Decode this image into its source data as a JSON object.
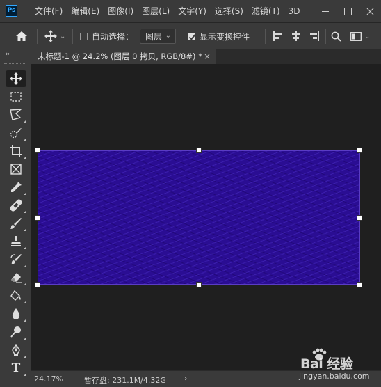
{
  "app": {
    "logo_text": "Ps",
    "menu": [
      "文件(F)",
      "编辑(E)",
      "图像(I)",
      "图层(L)",
      "文字(Y)",
      "选择(S)",
      "滤镜(T)",
      "3D"
    ]
  },
  "options_bar": {
    "auto_select_label": "自动选择：",
    "auto_select_checked": false,
    "target_dropdown_value": "图层",
    "show_transform_label": "显示变换控件",
    "show_transform_checked": true
  },
  "document_tab": {
    "title": "未标题-1 @ 24.2% (图层 0 拷贝, RGB/8#) *",
    "close_glyph": "×"
  },
  "tools": [
    {
      "name": "move-tool",
      "icon": "move-icon",
      "active": true
    },
    {
      "name": "marquee-tool",
      "icon": "rect-marquee-icon"
    },
    {
      "name": "lasso-tool",
      "icon": "polygon-lasso-icon"
    },
    {
      "name": "quick-select-tool",
      "icon": "quick-select-icon"
    },
    {
      "name": "crop-tool",
      "icon": "crop-icon"
    },
    {
      "name": "frame-tool",
      "icon": "frame-icon"
    },
    {
      "name": "eyedropper-tool",
      "icon": "eyedropper-icon"
    },
    {
      "name": "healing-tool",
      "icon": "bandage-icon"
    },
    {
      "name": "brush-tool",
      "icon": "brush-icon"
    },
    {
      "name": "stamp-tool",
      "icon": "clone-stamp-icon"
    },
    {
      "name": "history-brush-tool",
      "icon": "history-brush-icon"
    },
    {
      "name": "eraser-tool",
      "icon": "eraser-icon"
    },
    {
      "name": "paint-bucket-tool",
      "icon": "paint-bucket-icon"
    },
    {
      "name": "blur-tool",
      "icon": "droplet-icon"
    },
    {
      "name": "dodge-tool",
      "icon": "dodge-icon"
    },
    {
      "name": "pen-tool",
      "icon": "pen-icon"
    },
    {
      "name": "type-tool",
      "icon": "type-icon",
      "glyph": "T"
    }
  ],
  "canvas": {
    "fill_color": "#2a0d93",
    "pattern_color": "#5a3cc4"
  },
  "status_bar": {
    "zoom": "24.17%",
    "scratch": "暂存盘: 231.1M/4.32G",
    "arrow": "›"
  },
  "watermark": {
    "brand": "Bai 经验",
    "url": "jingyan.baidu.com"
  }
}
